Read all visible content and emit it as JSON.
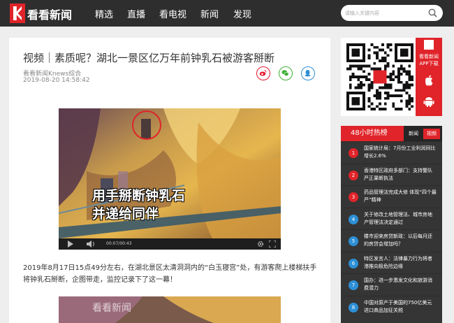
{
  "header": {
    "brand": "看看新闻",
    "nav": [
      "精选",
      "直播",
      "看电视",
      "新闻",
      "发现"
    ],
    "search_placeholder": "请输入关键内容"
  },
  "article": {
    "title": "视频｜素质呢？湖北一景区亿万年前钟乳石被游客掰断",
    "source": "看看新闻Knews综合",
    "date": "2019-08-20 14:58:42",
    "share": [
      "weibo-icon",
      "wechat-icon",
      "qq-icon"
    ],
    "video": {
      "caption_line1": "用手掰断钟乳石",
      "caption_line2": "并递给同伴",
      "time": "00:07/00:43"
    },
    "paragraph": "2019年8月17日15点49分左右，在湖北景区太清洞洞内的“白玉寝宫”处，有游客爬上楼梯扶手将钟乳石掰断，企图带走，监控记录下了这一幕！",
    "video2_watermark": "看看新闻"
  },
  "sidebar": {
    "app": {
      "title": "看看新闻",
      "subtitle": "APP下载"
    },
    "hot": {
      "title": "48小时热榜",
      "tabs": [
        "新闻",
        "视频"
      ],
      "items": [
        {
          "rank": "1",
          "text": "国家统计局：7月份工业利润同比增长2.6%"
        },
        {
          "rank": "2",
          "text": "香港特区政府多部门：支持警队严正果断执法"
        },
        {
          "rank": "3",
          "text": "药品管理法完成大修 体现“四个最严”精神"
        },
        {
          "rank": "4",
          "text": "关于修改土地管理法、城市房地产管理法决定通过"
        },
        {
          "rank": "5",
          "text": "楼市迎来房贷新政：以后每月还的房贷会增加吗？"
        },
        {
          "rank": "6",
          "text": "特区发言人：法律暴力行为将者港推向极危险边缘"
        },
        {
          "rank": "7",
          "text": "国办：进一步激发文化和旅游消费潜力"
        },
        {
          "rank": "8",
          "text": "中国对原产于美国的750亿美元进口商品加征关税"
        }
      ]
    }
  },
  "colors": {
    "brand_red": "#e0242a",
    "header_bg": "#2e2e2e",
    "weibo": "#e6162d",
    "wechat": "#3cb034",
    "qq": "#2d8fd5",
    "rank_top": "#e0242a",
    "rank_other": "#2d8fd5"
  }
}
